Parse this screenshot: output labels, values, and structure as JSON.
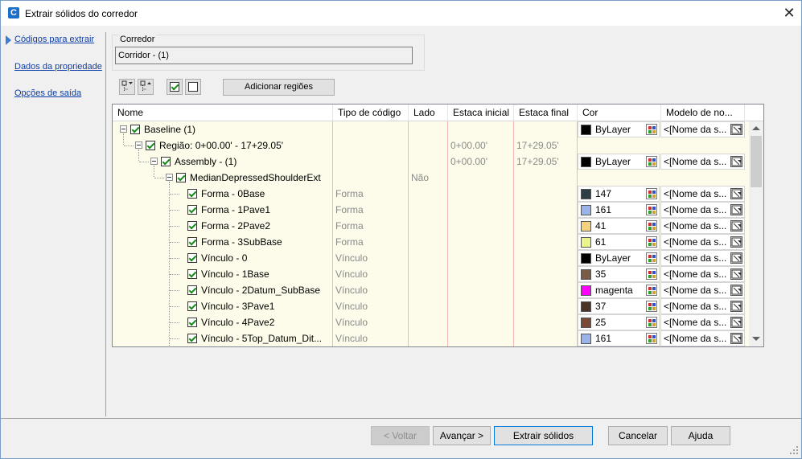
{
  "window": {
    "title": "Extrair sólidos do corredor",
    "app_icon": "C"
  },
  "nav": {
    "items": [
      {
        "label": "Códigos para extrair",
        "selected": true
      },
      {
        "label": "Dados da propriedade",
        "selected": false
      },
      {
        "label": "Opções de saída",
        "selected": false
      }
    ]
  },
  "corridor": {
    "group_label": "Corredor",
    "value": "Corridor - (1)"
  },
  "toolbar": {
    "add_regions_label": "Adicionar regiões"
  },
  "grid": {
    "headers": [
      "Nome",
      "Tipo de código",
      "Lado",
      "Estaca inicial",
      "Estaca final",
      "Cor",
      "Modelo de no..."
    ],
    "rows": [
      {
        "level": 0,
        "name": "Baseline (1)",
        "type": "",
        "side": "",
        "start": "",
        "end": "",
        "color": {
          "swatch": "#000000",
          "label": "ByLayer"
        },
        "template": "<[Nome da s..."
      },
      {
        "level": 1,
        "name": "Região: 0+00.00' - 17+29.05'",
        "type": "",
        "side": "",
        "start": "0+00.00'",
        "end": "17+29.05'",
        "color": null,
        "template": ""
      },
      {
        "level": 2,
        "name": "Assembly - (1)",
        "type": "",
        "side": "",
        "start": "0+00.00'",
        "end": "17+29.05'",
        "color": {
          "swatch": "#000000",
          "label": "ByLayer"
        },
        "template": "<[Nome da s..."
      },
      {
        "level": 3,
        "name": "MedianDepressedShoulderExt",
        "type": "",
        "side": "Não",
        "start": "",
        "end": "",
        "color": null,
        "template": ""
      },
      {
        "level": 4,
        "name": "Forma - 0Base",
        "type": "Forma",
        "side": "",
        "start": "",
        "end": "",
        "color": {
          "swatch": "#2d3f44",
          "label": "147"
        },
        "template": "<[Nome da s..."
      },
      {
        "level": 4,
        "name": "Forma - 1Pave1",
        "type": "Forma",
        "side": "",
        "start": "",
        "end": "",
        "color": {
          "swatch": "#9ab3e8",
          "label": "161"
        },
        "template": "<[Nome da s..."
      },
      {
        "level": 4,
        "name": "Forma - 2Pave2",
        "type": "Forma",
        "side": "",
        "start": "",
        "end": "",
        "color": {
          "swatch": "#f7d27c",
          "label": "41"
        },
        "template": "<[Nome da s..."
      },
      {
        "level": 4,
        "name": "Forma - 3SubBase",
        "type": "Forma",
        "side": "",
        "start": "",
        "end": "",
        "color": {
          "swatch": "#e9f48a",
          "label": "61"
        },
        "template": "<[Nome da s..."
      },
      {
        "level": 4,
        "name": "Vínculo - 0",
        "type": "Vínculo",
        "side": "",
        "start": "",
        "end": "",
        "color": {
          "swatch": "#000000",
          "label": "ByLayer"
        },
        "template": "<[Nome da s..."
      },
      {
        "level": 4,
        "name": "Vínculo - 1Base",
        "type": "Vínculo",
        "side": "",
        "start": "",
        "end": "",
        "color": {
          "swatch": "#7a5b46",
          "label": "35"
        },
        "template": "<[Nome da s..."
      },
      {
        "level": 4,
        "name": "Vínculo - 2Datum_SubBase",
        "type": "Vínculo",
        "side": "",
        "start": "",
        "end": "",
        "color": {
          "swatch": "#ff00ff",
          "label": "magenta"
        },
        "template": "<[Nome da s..."
      },
      {
        "level": 4,
        "name": "Vínculo - 3Pave1",
        "type": "Vínculo",
        "side": "",
        "start": "",
        "end": "",
        "color": {
          "swatch": "#4a3426",
          "label": "37"
        },
        "template": "<[Nome da s..."
      },
      {
        "level": 4,
        "name": "Vínculo - 4Pave2",
        "type": "Vínculo",
        "side": "",
        "start": "",
        "end": "",
        "color": {
          "swatch": "#7a4a36",
          "label": "25"
        },
        "template": "<[Nome da s..."
      },
      {
        "level": 4,
        "name": "Vínculo - 5Top_Datum_Dit...",
        "type": "Vínculo",
        "side": "",
        "start": "",
        "end": "",
        "color": {
          "swatch": "#9ab3e8",
          "label": "161"
        },
        "template": "<[Nome da s..."
      }
    ]
  },
  "footer": {
    "back": "< Voltar",
    "next": "Avançar >",
    "extract": "Extrair sólidos",
    "cancel": "Cancelar",
    "help": "Ajuda"
  }
}
